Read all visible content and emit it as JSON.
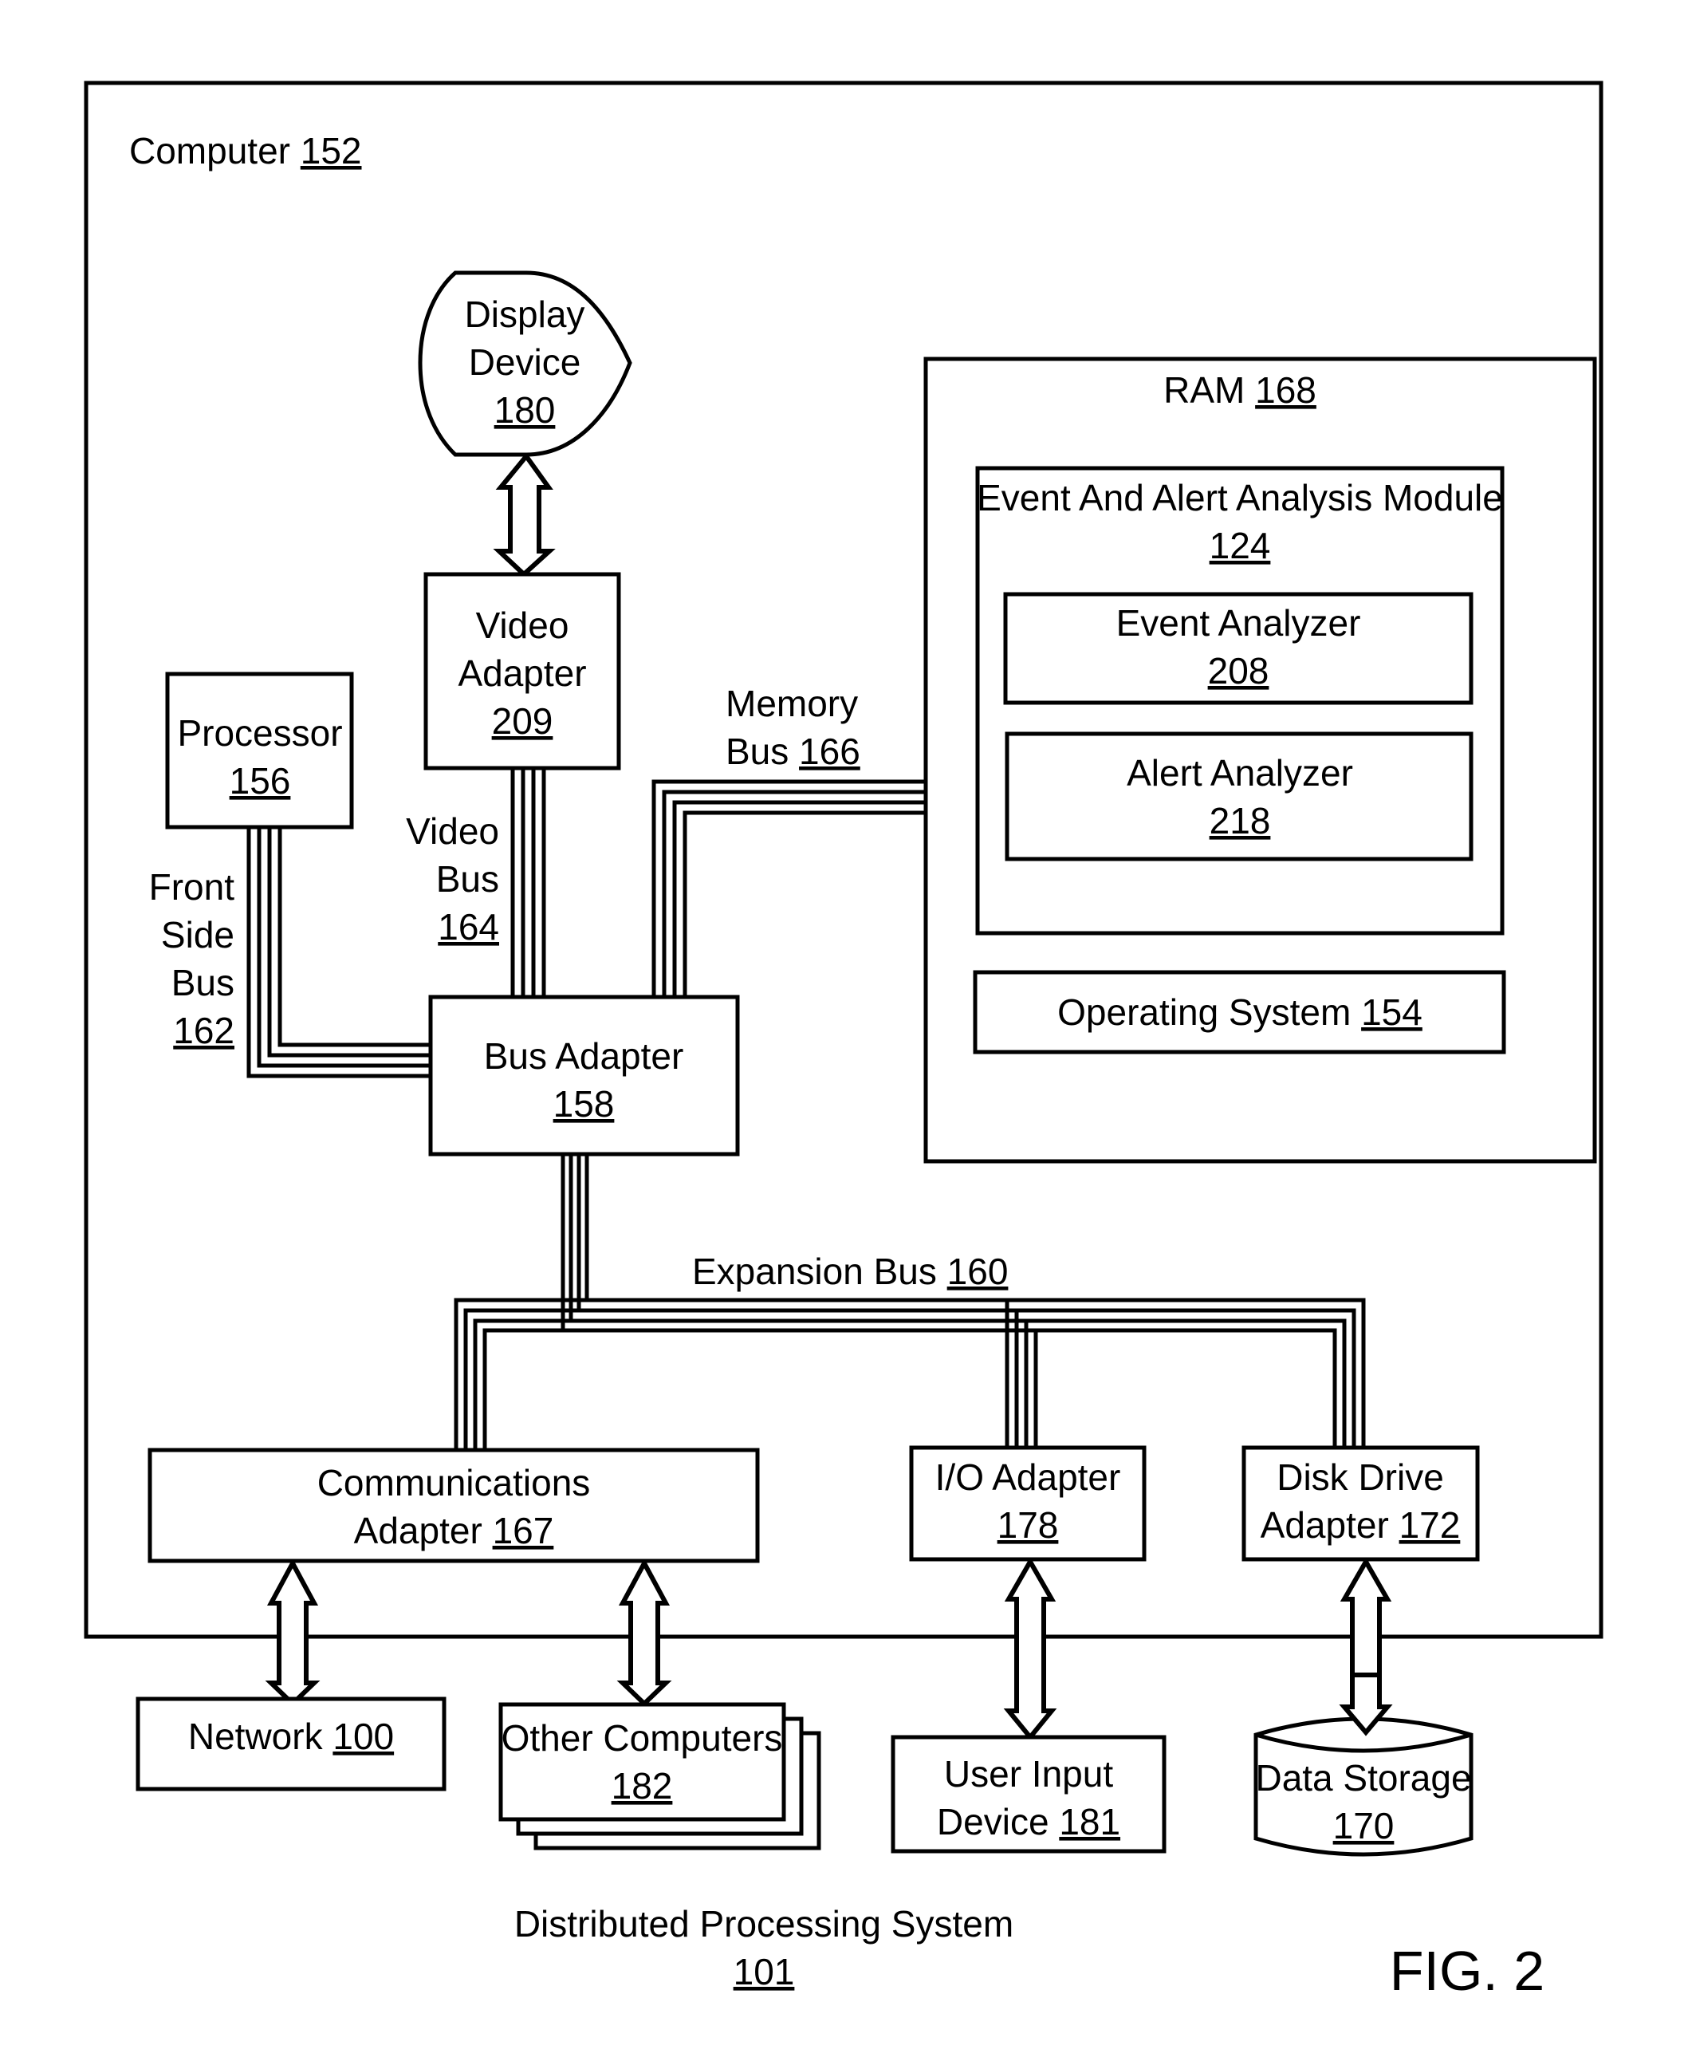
{
  "figure_label": "FIG. 2",
  "system": {
    "name": "Distributed Processing System",
    "ref": "101"
  },
  "computer": {
    "name": "Computer",
    "ref": "152"
  },
  "components": {
    "display_device": {
      "lines": [
        "Display",
        "Device"
      ],
      "ref": "180"
    },
    "video_adapter": {
      "lines": [
        "Video",
        "Adapter"
      ],
      "ref": "209"
    },
    "processor": {
      "lines": [
        "Processor"
      ],
      "ref": "156"
    },
    "bus_adapter": {
      "lines": [
        "Bus Adapter"
      ],
      "ref": "158"
    },
    "ram": {
      "name": "RAM",
      "ref": "168"
    },
    "analysis_module": {
      "name": "Event And Alert Analysis Module",
      "ref": "124"
    },
    "event_analyzer": {
      "name": "Event Analyzer",
      "ref": "208"
    },
    "alert_analyzer": {
      "name": "Alert Analyzer",
      "ref": "218"
    },
    "operating_system": {
      "name": "Operating System",
      "ref": "154"
    },
    "communications_adapter": {
      "lines": [
        "Communications",
        "Adapter"
      ],
      "ref": "167"
    },
    "io_adapter": {
      "lines": [
        "I/O Adapter"
      ],
      "ref": "178"
    },
    "disk_drive_adapter": {
      "lines": [
        "Disk Drive",
        "Adapter"
      ],
      "ref": "172"
    },
    "network": {
      "name": "Network",
      "ref": "100"
    },
    "other_computers": {
      "name": "Other Computers",
      "ref": "182"
    },
    "user_input_device": {
      "lines": [
        "User Input",
        "Device"
      ],
      "ref": "181"
    },
    "data_storage": {
      "name": "Data Storage",
      "ref": "170"
    }
  },
  "buses": {
    "front_side_bus": {
      "lines": [
        "Front",
        "Side",
        "Bus"
      ],
      "ref": "162"
    },
    "video_bus": {
      "lines": [
        "Video",
        "Bus"
      ],
      "ref": "164"
    },
    "memory_bus": {
      "lines": [
        "Memory",
        "Bus"
      ],
      "ref": "166"
    },
    "expansion_bus": {
      "name": "Expansion Bus",
      "ref": "160"
    }
  }
}
